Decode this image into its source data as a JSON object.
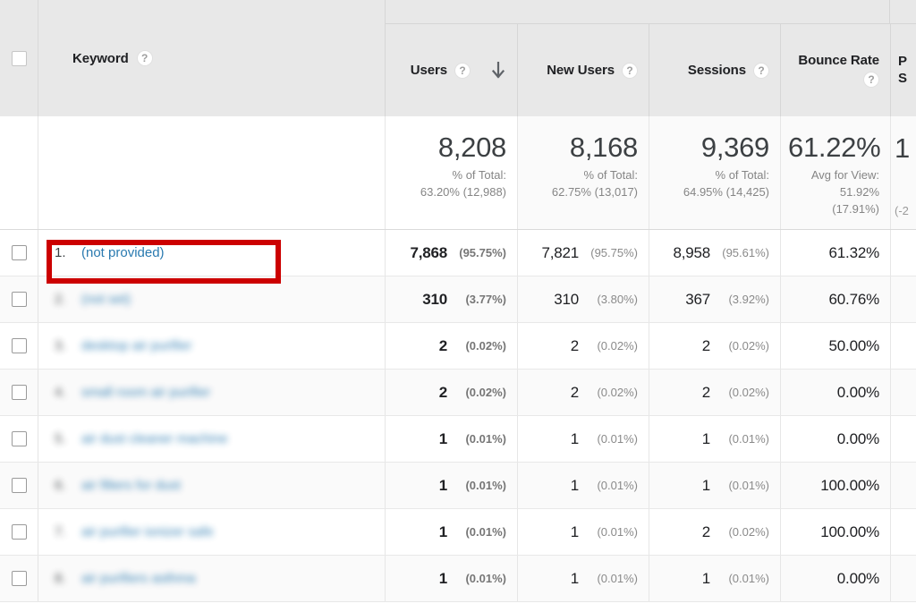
{
  "table": {
    "dimension_header": {
      "label": "Keyword",
      "help": "?"
    },
    "sort_indicator": "descending-arrow",
    "columns": [
      {
        "name": "users",
        "label": "Users",
        "help": "?",
        "sorted": true
      },
      {
        "name": "new_users",
        "label": "New Users",
        "help": "?",
        "sorted": false
      },
      {
        "name": "sessions",
        "label": "Sessions",
        "help": "?",
        "sorted": false
      },
      {
        "name": "bounce",
        "label": "Bounce Rate",
        "help": "?",
        "sorted": false
      },
      {
        "name": "pages",
        "label_line1": "P",
        "label_line2": "S",
        "sorted": false
      }
    ],
    "summary": {
      "users": {
        "value": "8,208",
        "sub_line1": "% of Total:",
        "sub_line2": "63.20% (12,988)"
      },
      "new_users": {
        "value": "8,168",
        "sub_line1": "% of Total:",
        "sub_line2": "62.75% (13,017)"
      },
      "sessions": {
        "value": "9,369",
        "sub_line1": "% of Total:",
        "sub_line2": "64.95% (14,425)"
      },
      "bounce": {
        "value": "61.22%",
        "sub_line1": "Avg for View:",
        "sub_line2": "51.92%",
        "sub_line3": "(17.91%)"
      },
      "pages": {
        "value": "1",
        "sub": "(-2"
      }
    },
    "rows": [
      {
        "index": "1.",
        "keyword": "(not provided)",
        "blurred": false,
        "highlighted": true,
        "users": "7,868",
        "users_pct": "(95.75%)",
        "new_users": "7,821",
        "new_users_pct": "(95.75%)",
        "sessions": "8,958",
        "sessions_pct": "(95.61%)",
        "bounce": "61.32%"
      },
      {
        "index": "2.",
        "keyword": "(not set)",
        "blurred": true,
        "highlighted": false,
        "users": "310",
        "users_pct": "(3.77%)",
        "new_users": "310",
        "new_users_pct": "(3.80%)",
        "sessions": "367",
        "sessions_pct": "(3.92%)",
        "bounce": "60.76%"
      },
      {
        "index": "3.",
        "keyword": "desktop air purifier",
        "blurred": true,
        "highlighted": false,
        "users": "2",
        "users_pct": "(0.02%)",
        "new_users": "2",
        "new_users_pct": "(0.02%)",
        "sessions": "2",
        "sessions_pct": "(0.02%)",
        "bounce": "50.00%"
      },
      {
        "index": "4.",
        "keyword": "small room air purifier",
        "blurred": true,
        "highlighted": false,
        "users": "2",
        "users_pct": "(0.02%)",
        "new_users": "2",
        "new_users_pct": "(0.02%)",
        "sessions": "2",
        "sessions_pct": "(0.02%)",
        "bounce": "0.00%"
      },
      {
        "index": "5.",
        "keyword": "air dust cleaner machine",
        "blurred": true,
        "highlighted": false,
        "users": "1",
        "users_pct": "(0.01%)",
        "new_users": "1",
        "new_users_pct": "(0.01%)",
        "sessions": "1",
        "sessions_pct": "(0.01%)",
        "bounce": "0.00%"
      },
      {
        "index": "6.",
        "keyword": "air filters for dust",
        "blurred": true,
        "highlighted": false,
        "users": "1",
        "users_pct": "(0.01%)",
        "new_users": "1",
        "new_users_pct": "(0.01%)",
        "sessions": "1",
        "sessions_pct": "(0.01%)",
        "bounce": "100.00%"
      },
      {
        "index": "7.",
        "keyword": "air purifier ionizer safe",
        "blurred": true,
        "highlighted": false,
        "users": "1",
        "users_pct": "(0.01%)",
        "new_users": "1",
        "new_users_pct": "(0.01%)",
        "sessions": "2",
        "sessions_pct": "(0.02%)",
        "bounce": "100.00%"
      },
      {
        "index": "8.",
        "keyword": "air purifiers asthma",
        "blurred": true,
        "highlighted": false,
        "users": "1",
        "users_pct": "(0.01%)",
        "new_users": "1",
        "new_users_pct": "(0.01%)",
        "sessions": "1",
        "sessions_pct": "(0.01%)",
        "bounce": "0.00%"
      }
    ],
    "colors": {
      "highlight_box": "#cc0000",
      "link": "#2a7ab0",
      "header_bg": "#e8e8e8",
      "alt_row_bg": "#fafafa"
    }
  }
}
